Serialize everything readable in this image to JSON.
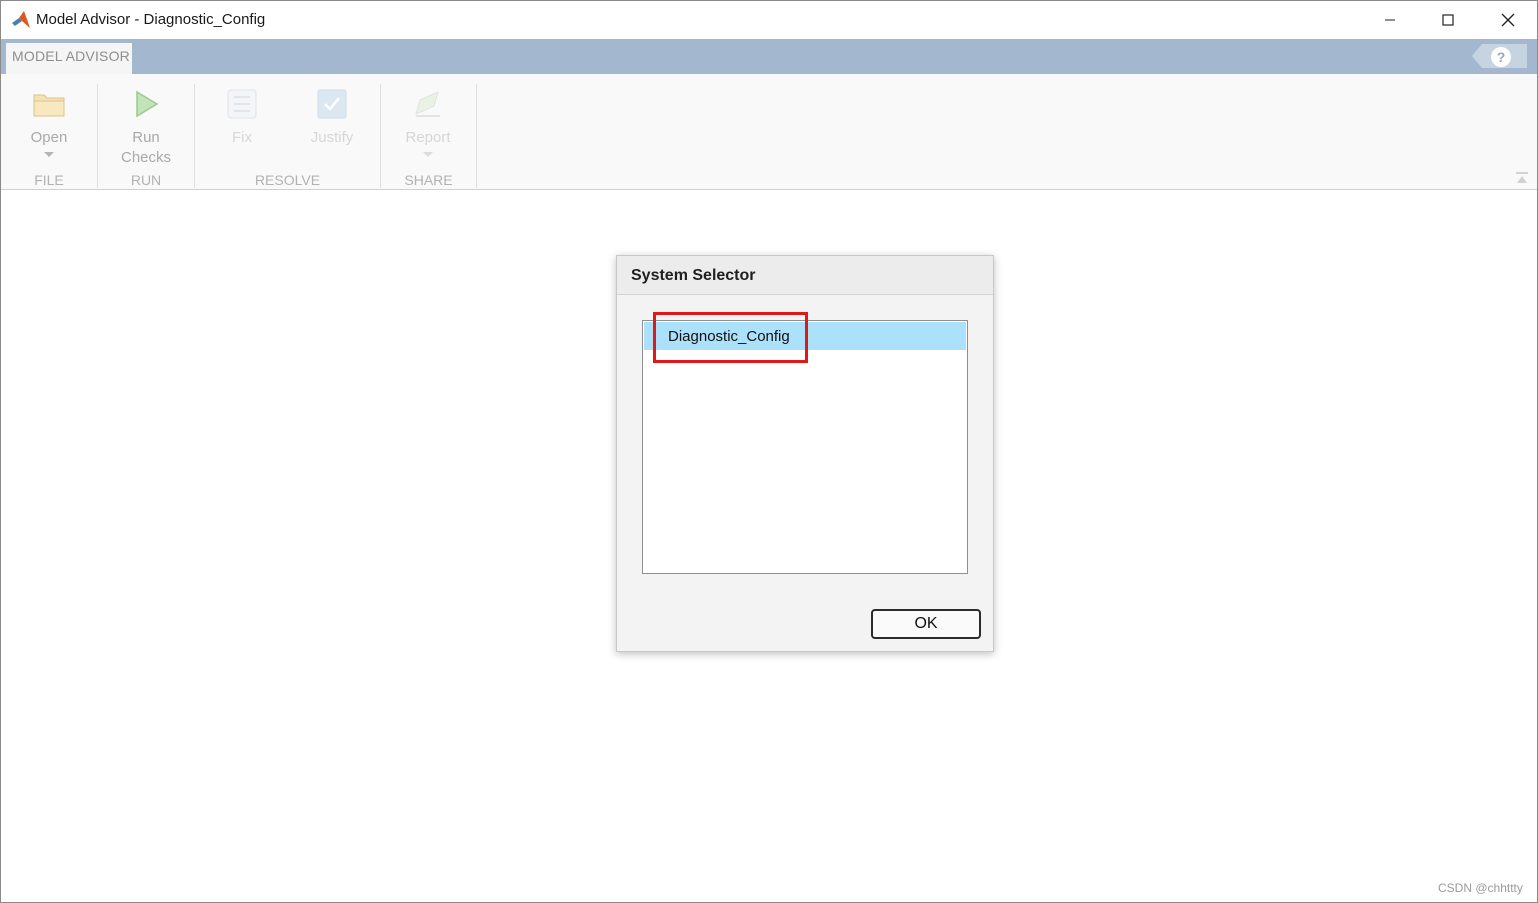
{
  "window": {
    "title": "Model Advisor - Diagnostic_Config"
  },
  "ribbon": {
    "active_tab": "MODEL ADVISOR",
    "help_label": "?",
    "groups": {
      "file": {
        "label": "FILE",
        "open_label": "Open"
      },
      "run": {
        "label": "RUN",
        "run_line1": "Run",
        "run_line2": "Checks"
      },
      "resolve": {
        "label": "RESOLVE",
        "fix_label": "Fix",
        "justify_label": "Justify"
      },
      "share": {
        "label": "SHARE",
        "report_label": "Report"
      }
    }
  },
  "dialog": {
    "title": "System Selector",
    "items": [
      "Diagnostic_Config"
    ],
    "ok_label": "OK"
  },
  "watermark": "CSDN @chhttty",
  "icons": {
    "app": "matlab-logo-icon",
    "open": "folder-icon",
    "run": "play-icon",
    "fix": "checklist-icon",
    "justify": "justify-check-icon",
    "report": "report-icon"
  },
  "colors": {
    "tab_strip": "#a3b8cf",
    "selection": "#ace1fc",
    "highlight_box": "#e01818",
    "run_icon": "#a8d59a"
  }
}
